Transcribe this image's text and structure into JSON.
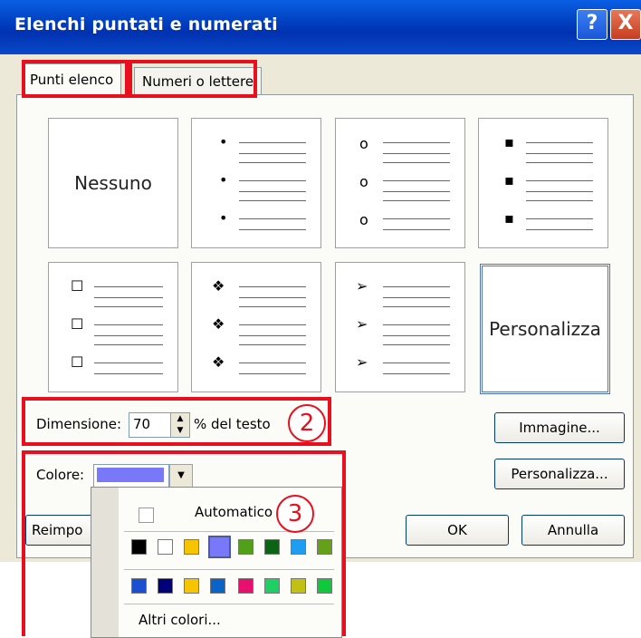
{
  "dialog": {
    "title": "Elenchi puntati e numerati"
  },
  "titlebar": {
    "help": "?",
    "close": "X"
  },
  "tabs": [
    {
      "label": "Punti elenco"
    },
    {
      "label": "Numeri o lettere"
    }
  ],
  "gallery": {
    "none_label": "Nessuno",
    "custom_label": "Personalizza",
    "bullets": [
      "•",
      "o",
      "▪",
      "☐",
      "❖",
      "➢"
    ]
  },
  "size": {
    "label": "Dimensione:",
    "value": "70",
    "unit": "% del testo"
  },
  "color": {
    "label": "Colore:",
    "selected": "#7878f8"
  },
  "buttons": {
    "image": "Immagine...",
    "customize": "Personalizza...",
    "reset": "Reimpo",
    "ok": "OK",
    "cancel": "Annulla"
  },
  "color_menu": {
    "automatic": "Automatico",
    "more": "Altri colori...",
    "row1": [
      "#000000",
      "#ffffff",
      "#f7c400",
      "#7878f8",
      "#52a019",
      "#0a6414",
      "#1e9ef0",
      "#65a019"
    ],
    "row2": [
      "#1a4fd0",
      "#00007a",
      "#f7c400",
      "#0a64c8",
      "#e8106e",
      "#1ecf64",
      "#c0c015",
      "#10c83c"
    ]
  },
  "annotations": {
    "two": "2",
    "three": "3"
  }
}
